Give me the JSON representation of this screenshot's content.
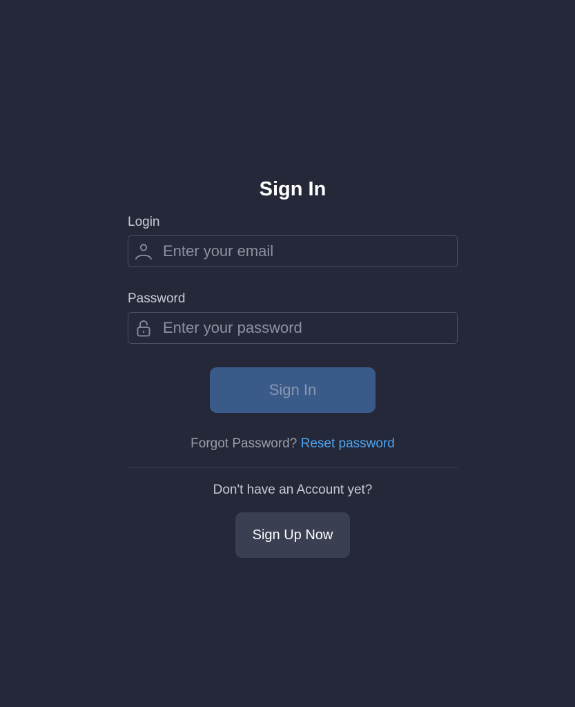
{
  "form": {
    "title": "Sign In",
    "login": {
      "label": "Login",
      "placeholder": "Enter your email",
      "value": "",
      "icon": "user-icon"
    },
    "password": {
      "label": "Password",
      "placeholder": "Enter your password",
      "value": "",
      "icon": "lock-icon"
    },
    "submit_label": "Sign In",
    "forgot_text": "Forgot Password?",
    "reset_link": "Reset password",
    "no_account_text": "Don't have an Account yet?",
    "signup_label": "Sign Up Now"
  },
  "colors": {
    "background": "#242838",
    "primary_button": "#3a5a89",
    "secondary_button": "#3b3f52",
    "link": "#4ea3f0"
  }
}
